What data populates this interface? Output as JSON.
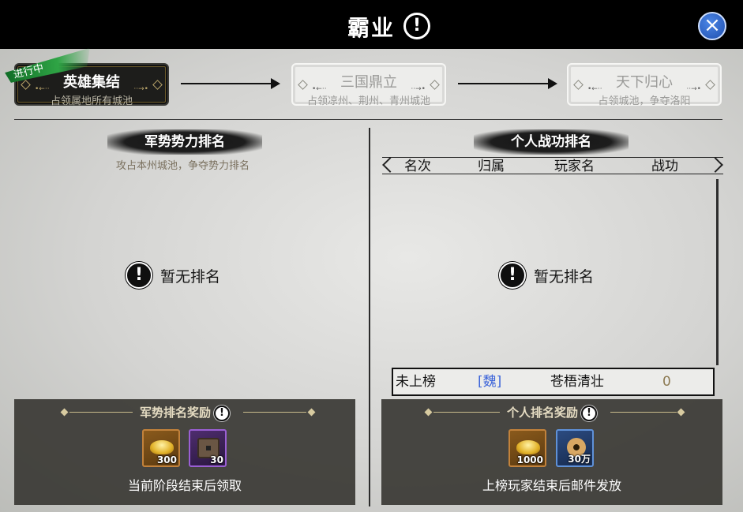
{
  "header": {
    "title": "霸业",
    "info_icon": "!",
    "close_icon": "×"
  },
  "stages": [
    {
      "name": "英雄集结",
      "desc": "占领属地所有城池",
      "badge": "进行中",
      "status": "active"
    },
    {
      "name": "三国鼎立",
      "desc": "占领凉州、荆州、青州城池",
      "status": "inactive"
    },
    {
      "name": "天下归心",
      "desc": "占领城池，争夺洛阳",
      "status": "inactive"
    }
  ],
  "left": {
    "title": "军势势力排名",
    "subtitle": "攻占本州城池，争夺势力排名",
    "empty_text": "暂无排名",
    "reward": {
      "title": "军势排名奖励",
      "items": [
        {
          "icon": "gold-ingot-icon",
          "count": "300",
          "rarity": "orange"
        },
        {
          "icon": "chest-icon",
          "count": "30",
          "rarity": "purple"
        }
      ],
      "note": "当前阶段结束后领取"
    }
  },
  "right": {
    "title": "个人战功排名",
    "columns": [
      "名次",
      "归属",
      "玩家名",
      "战功"
    ],
    "empty_text": "暂无排名",
    "my_row": {
      "rank": "未上榜",
      "faction": "[魏]",
      "player": "苍梧清壮",
      "merit": "0"
    },
    "reward": {
      "title": "个人排名奖励",
      "items": [
        {
          "icon": "gold-ingot-icon",
          "count": "1000",
          "rarity": "orange"
        },
        {
          "icon": "copper-coins-icon",
          "count": "30万",
          "rarity": "blue"
        }
      ],
      "note": "上榜玩家结束后邮件发放"
    }
  },
  "colors": {
    "faction": "#3b63d9",
    "merit": "#8c7a52",
    "badge_green": "#2fa445"
  }
}
